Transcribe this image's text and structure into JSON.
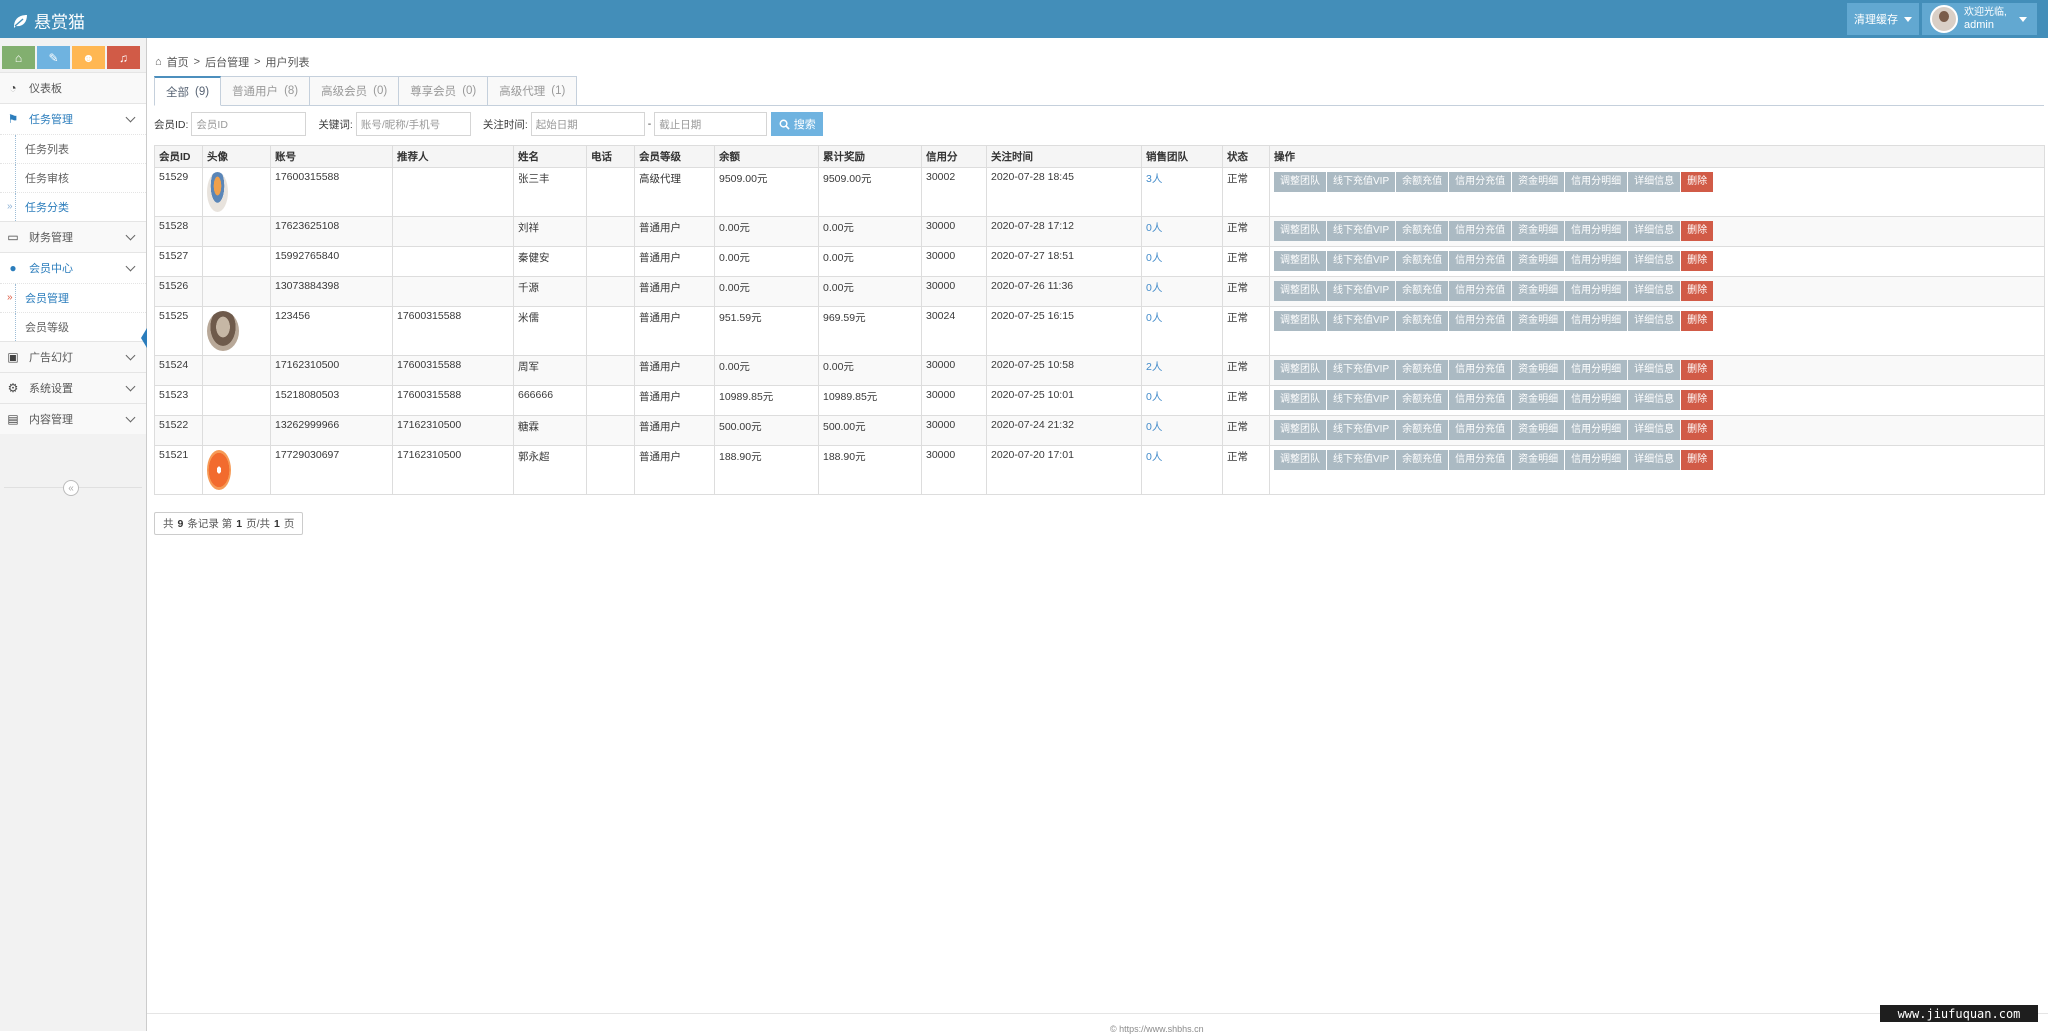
{
  "navbar": {
    "brand": "悬赏猫",
    "cache_label": "清理缓存",
    "welcome": "欢迎光临,",
    "username": "admin"
  },
  "sidebar": {
    "menu": [
      {
        "label": "仪表板",
        "icon": "dashboard-icon"
      },
      {
        "label": "任务管理",
        "icon": "flag-icon",
        "open": true,
        "children": [
          "任务列表",
          "任务审核",
          "任务分类"
        ]
      },
      {
        "label": "财务管理",
        "icon": "inbox-icon"
      },
      {
        "label": "会员中心",
        "icon": "user-icon",
        "open": true,
        "children": [
          "会员管理",
          "会员等级"
        ]
      },
      {
        "label": "广告幻灯",
        "icon": "picture-icon"
      },
      {
        "label": "系统设置",
        "icon": "gear-icon"
      },
      {
        "label": "内容管理",
        "icon": "book-icon"
      }
    ]
  },
  "breadcrumb": [
    "首页",
    "后台管理",
    "用户列表"
  ],
  "tabs": [
    {
      "label": "全部",
      "count": "(9)"
    },
    {
      "label": "普通用户",
      "count": "(8)"
    },
    {
      "label": "高级会员",
      "count": "(0)"
    },
    {
      "label": "尊享会员",
      "count": "(0)"
    },
    {
      "label": "高级代理",
      "count": "(1)"
    }
  ],
  "filters": {
    "member_id_label": "会员ID:",
    "member_id_placeholder": "会员ID",
    "keyword_label": "关键词:",
    "keyword_placeholder": "账号/昵称/手机号",
    "date_label": "关注时间:",
    "start_placeholder": "起始日期",
    "date_sep": "-",
    "end_placeholder": "截止日期",
    "search_label": "搜索"
  },
  "table": {
    "columns": [
      "会员ID",
      "头像",
      "账号",
      "推荐人",
      "姓名",
      "电话",
      "会员等级",
      "余额",
      "累计奖励",
      "信用分",
      "关注时间",
      "销售团队",
      "状态",
      "操作"
    ],
    "actions": [
      "调整团队",
      "线下充值VIP",
      "余额充值",
      "信用分充值",
      "资金明细",
      "信用分明细",
      "详细信息",
      "删除"
    ],
    "rows": [
      {
        "id": "51529",
        "avatar": "pic1",
        "account": "17600315588",
        "referrer": "",
        "name": "张三丰",
        "phone": "",
        "level": "高级代理",
        "balance": "9509.00元",
        "reward": "9509.00元",
        "credit": "30002",
        "time": "2020-07-28 18:45",
        "team": "3人",
        "status": "正常"
      },
      {
        "id": "51528",
        "avatar": "",
        "account": "17623625108",
        "referrer": "",
        "name": "刘祥",
        "phone": "",
        "level": "普通用户",
        "balance": "0.00元",
        "reward": "0.00元",
        "credit": "30000",
        "time": "2020-07-28 17:12",
        "team": "0人",
        "status": "正常"
      },
      {
        "id": "51527",
        "avatar": "",
        "account": "15992765840",
        "referrer": "",
        "name": "秦健安",
        "phone": "",
        "level": "普通用户",
        "balance": "0.00元",
        "reward": "0.00元",
        "credit": "30000",
        "time": "2020-07-27 18:51",
        "team": "0人",
        "status": "正常"
      },
      {
        "id": "51526",
        "avatar": "",
        "account": "13073884398",
        "referrer": "",
        "name": "千源",
        "phone": "",
        "level": "普通用户",
        "balance": "0.00元",
        "reward": "0.00元",
        "credit": "30000",
        "time": "2020-07-26 11:36",
        "team": "0人",
        "status": "正常"
      },
      {
        "id": "51525",
        "avatar": "pic2",
        "account": "123456",
        "referrer": "17600315588",
        "name": "米儒",
        "phone": "",
        "level": "普通用户",
        "balance": "951.59元",
        "reward": "969.59元",
        "credit": "30024",
        "time": "2020-07-25 16:15",
        "team": "0人",
        "status": "正常"
      },
      {
        "id": "51524",
        "avatar": "",
        "account": "17162310500",
        "referrer": "17600315588",
        "name": "周军",
        "phone": "",
        "level": "普通用户",
        "balance": "0.00元",
        "reward": "0.00元",
        "credit": "30000",
        "time": "2020-07-25 10:58",
        "team": "2人",
        "status": "正常"
      },
      {
        "id": "51523",
        "avatar": "",
        "account": "15218080503",
        "referrer": "17600315588",
        "name": "666666",
        "phone": "",
        "level": "普通用户",
        "balance": "10989.85元",
        "reward": "10989.85元",
        "credit": "30000",
        "time": "2020-07-25 10:01",
        "team": "0人",
        "status": "正常"
      },
      {
        "id": "51522",
        "avatar": "",
        "account": "13262999966",
        "referrer": "17162310500",
        "name": "糖霖",
        "phone": "",
        "level": "普通用户",
        "balance": "500.00元",
        "reward": "500.00元",
        "credit": "30000",
        "time": "2020-07-24 21:32",
        "team": "0人",
        "status": "正常"
      },
      {
        "id": "51521",
        "avatar": "pic3",
        "account": "17729030697",
        "referrer": "17162310500",
        "name": "郭永超",
        "phone": "",
        "level": "普通用户",
        "balance": "188.90元",
        "reward": "188.90元",
        "credit": "30000",
        "time": "2020-07-20 17:01",
        "team": "0人",
        "status": "正常"
      }
    ]
  },
  "pager": {
    "prefix": "共",
    "total": "9",
    "mid": "条记录 第",
    "page": "1",
    "mid2": "页/共",
    "pages": "1",
    "suffix": "页"
  },
  "footer": {
    "text": "© https://www.shbhs.cn"
  },
  "watermark": "www.jiufuquan.com",
  "colors": {
    "navbar": "#438eb9",
    "accent": "#2b7dbc",
    "danger": "#d15b47",
    "op_button": "#abbac3"
  }
}
